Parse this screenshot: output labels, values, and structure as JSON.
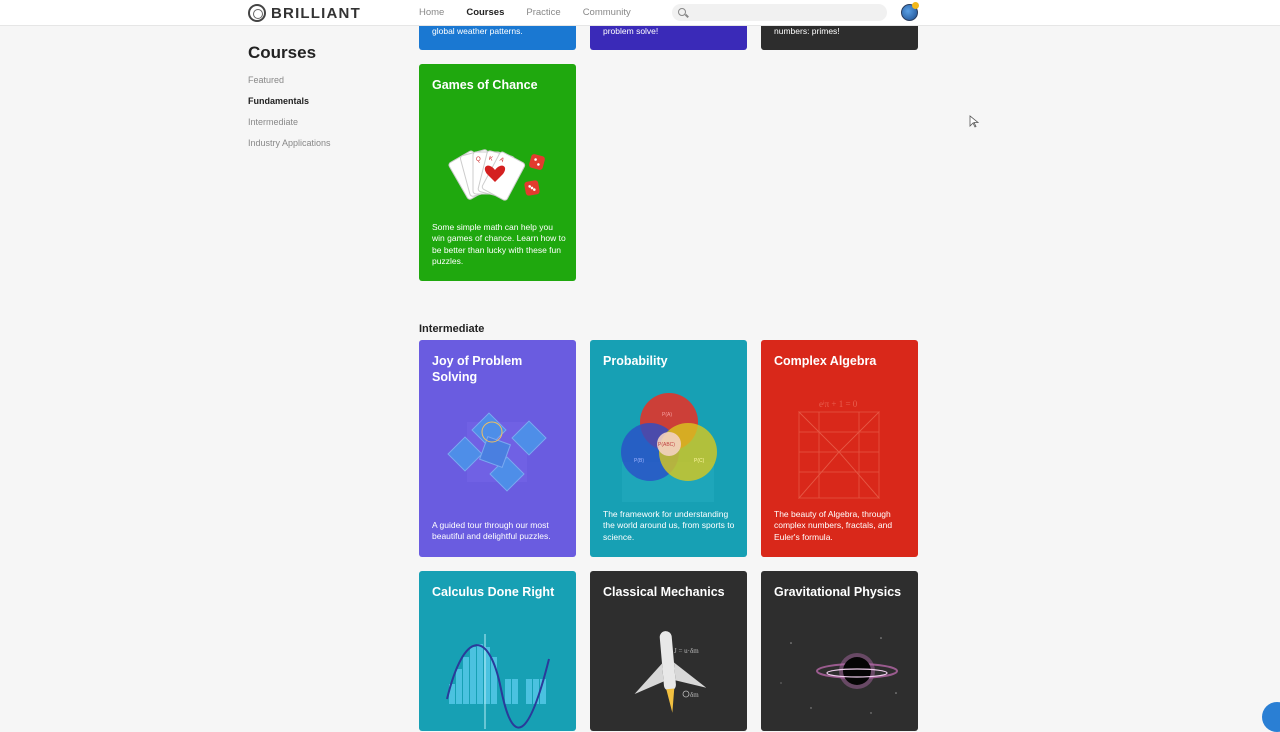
{
  "header": {
    "logo_text": "BRILLIANT",
    "nav": [
      "Home",
      "Courses",
      "Practice",
      "Community"
    ],
    "active_nav": "Courses",
    "search_placeholder": ""
  },
  "sidebar": {
    "title": "Courses",
    "items": [
      {
        "label": "Featured",
        "active": false
      },
      {
        "label": "Fundamentals",
        "active": true
      },
      {
        "label": "Intermediate",
        "active": false
      },
      {
        "label": "Industry Applications",
        "active": false
      }
    ]
  },
  "top_cut_cards": [
    {
      "text": "global weather patterns.",
      "color": "#1a78d2"
    },
    {
      "text": "problem solve!",
      "color": "#3a2ab8"
    },
    {
      "text": "numbers: primes!",
      "color": "#2d2d2d"
    }
  ],
  "fundamentals_cards": [
    {
      "title": "Games of Chance",
      "desc": "Some simple math can help you win games of chance. Learn how to be better than lucky with these fun puzzles.",
      "color": "#1fa80e",
      "icon": "playing-cards-dice-icon"
    }
  ],
  "intermediate": {
    "title": "Intermediate",
    "cards": [
      {
        "title": "Joy of Problem Solving",
        "desc": "A guided tour through our most beautiful and delightful puzzles.",
        "color": "#6a5ce0",
        "icon": "geometric-squares-icon"
      },
      {
        "title": "Probability",
        "desc": "The framework for understanding the world around us, from sports to science.",
        "color": "#17a0b4",
        "icon": "venn-diagram-icon",
        "venn_labels": [
          "P(A)",
          "P(B)",
          "P(C)",
          "P(ABC)"
        ]
      },
      {
        "title": "Complex Algebra",
        "desc": "The beauty of Algebra, through complex numbers, fractals, and Euler's formula.",
        "color": "#d9281a",
        "icon": "fractal-triangles-icon",
        "formula": "eⁱπ + 1 = 0"
      },
      {
        "title": "Calculus Done Right",
        "color": "#17a0b4",
        "icon": "riemann-sum-curve-icon"
      },
      {
        "title": "Classical Mechanics",
        "color": "#2e2e2e",
        "icon": "rocket-icon",
        "annotations": [
          "J = u·δm",
          "δm"
        ]
      },
      {
        "title": "Gravitational Physics",
        "color": "#2e2e2e",
        "icon": "black-hole-icon"
      }
    ]
  }
}
